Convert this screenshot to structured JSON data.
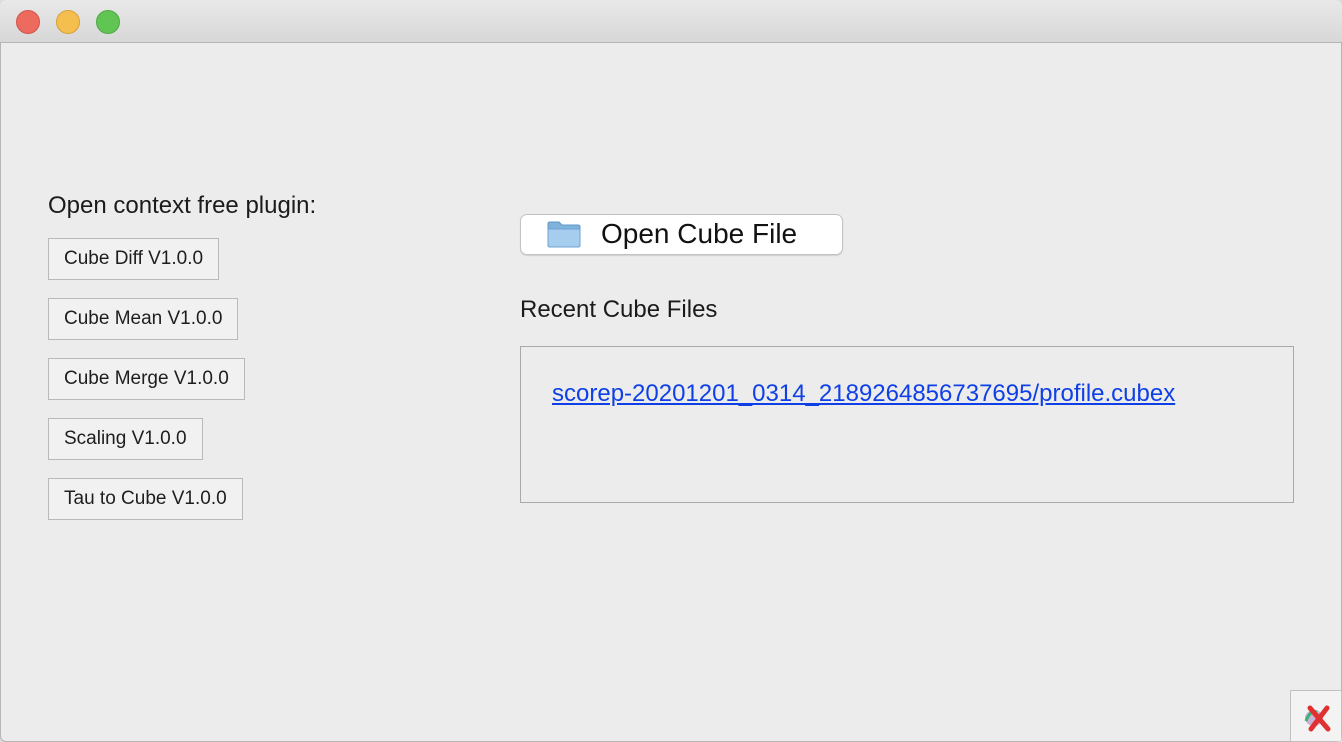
{
  "window": {
    "controls": [
      "close",
      "minimize",
      "maximize"
    ]
  },
  "plugins": {
    "heading": "Open context free plugin:",
    "items": [
      {
        "label": "Cube Diff V1.0.0"
      },
      {
        "label": "Cube Mean V1.0.0"
      },
      {
        "label": "Cube Merge V1.0.0"
      },
      {
        "label": "Scaling V1.0.0"
      },
      {
        "label": "Tau to Cube V1.0.0"
      }
    ]
  },
  "open_file": {
    "label": "Open Cube File",
    "icon": "folder-icon"
  },
  "recent": {
    "heading": "Recent Cube Files",
    "files": [
      {
        "path": "scorep-20201201_0314_2189264856737695/profile.cubex"
      }
    ]
  },
  "corner": {
    "icon": "cube-x-icon"
  },
  "colors": {
    "link": "#0f3fe6",
    "close": "#ed6a5e",
    "minimize": "#f5bf4f",
    "maximize": "#61c554"
  }
}
